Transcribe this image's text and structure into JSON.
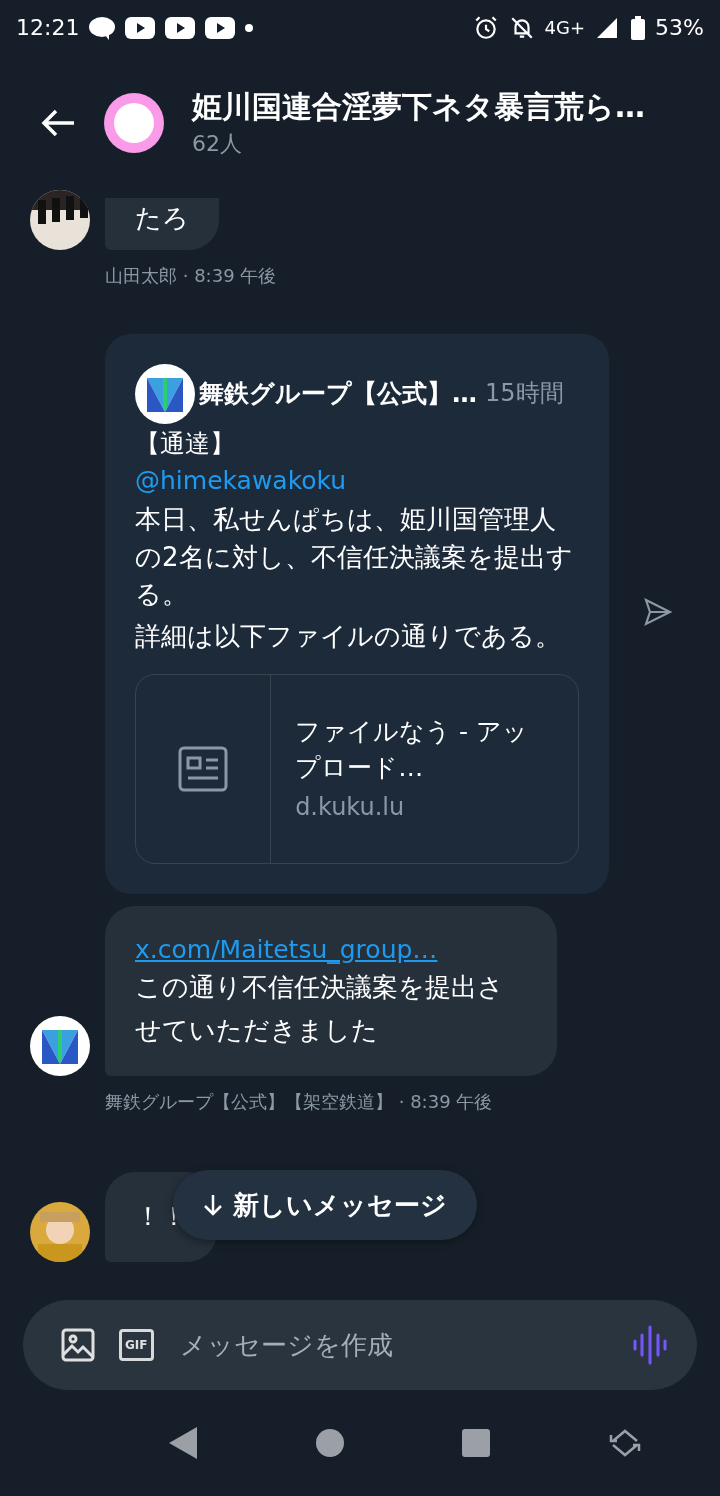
{
  "status_bar": {
    "time": "12:21",
    "network": "4G+",
    "battery": "53%"
  },
  "header": {
    "title": "姫川国連合淫夢下ネタ暴言荒ら…",
    "subtitle": "62人"
  },
  "messages": [
    {
      "kind": "text",
      "text": "たろ",
      "meta": "山田太郎 · 8:39 午後"
    },
    {
      "kind": "shared_post",
      "author": "舞鉄グループ【公式】…",
      "time": "15時間",
      "heading": "【通達】",
      "mention": "@himekawakoku",
      "body": [
        "本日、私せんぱちは、姫川国管理人の2名に対し、不信任決議案を提出する。",
        "詳細は以下ファイルの通りである。"
      ],
      "link_card": {
        "title": "ファイルなう - アップロード…",
        "domain": "d.kuku.lu"
      }
    },
    {
      "kind": "link_text",
      "link": "x.com/Maitetsu_group…",
      "text": "この通り不信任決議案を提出させていただきました",
      "meta": "舞鉄グループ【公式】【架空鉄道】 · 8:39 午後"
    },
    {
      "kind": "text",
      "text": "！！"
    }
  ],
  "new_messages_button": {
    "label": "新しいメッセージ"
  },
  "composer": {
    "gif": "GIF",
    "placeholder": "メッセージを作成"
  }
}
